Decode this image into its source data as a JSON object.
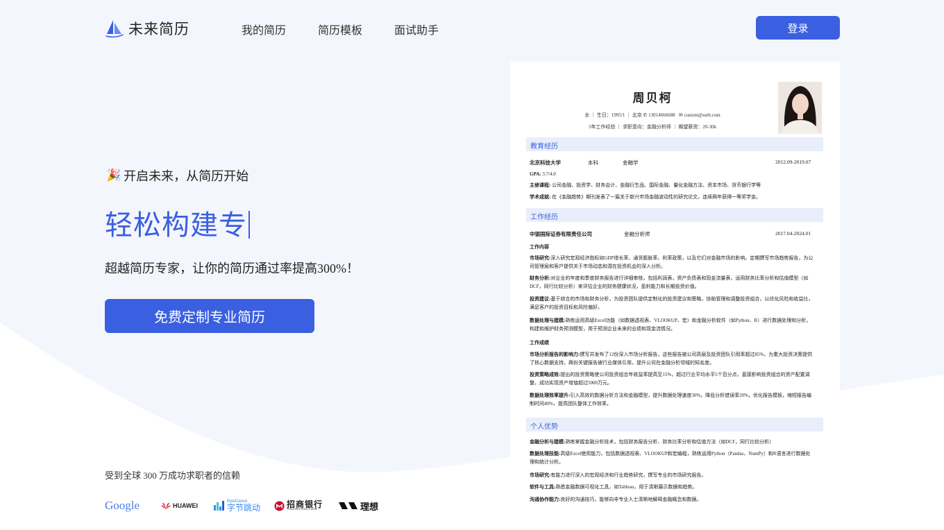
{
  "nav": {
    "logo_text": "未来简历",
    "links": [
      "我的简历",
      "简历模板",
      "面试助手"
    ],
    "login": "登录"
  },
  "hero": {
    "tagline": "开启未来，从简历开始",
    "title": "轻松构建专",
    "subtitle": "超越简历专家，让你的简历通过率提高300%！",
    "cta": "免费定制专业简历"
  },
  "trust": {
    "text": "受到全球 300 万成功求职者的信赖",
    "brands": [
      "Google",
      "HUAWEI",
      "ByteDance",
      "字节跳动",
      "招商银行",
      "CHINA MERCHANTS BANK",
      "理想"
    ]
  },
  "colors": {
    "accent": "#3a5fe0",
    "background": "#f4f6fd"
  },
  "resume": {
    "name": "周贝柯",
    "info1": {
      "gender": "女",
      "birth": "生日：1995/1",
      "city": "北京",
      "phone": "13014666688",
      "email": "custom@ustb.com"
    },
    "info2": {
      "experience": "5年工作经验",
      "intent": "求职意向：金融分析师",
      "salary": "期望薪资：20-30k"
    },
    "education": {
      "heading": "教育经历",
      "school": "北京科技大学",
      "degree": "本科",
      "major": "金融学",
      "period": "2012.09-2019.07",
      "gpa_label": "GPA:",
      "gpa": "3.7/4.0",
      "courses_label": "主修课程:",
      "courses": "公司金融、投资学、财务会计、金融衍生品、国际金融、量化金融方法、资本市场、货币银行学等",
      "achv_label": "学术成就:",
      "achv": "在《金融趋势》期刊发表了一篇关于新兴市场金融波动性的研究论文，连续两年获得一等奖学金。"
    },
    "work": {
      "heading": "工作经历",
      "company": "中银国际证券有限责任公司",
      "role": "金融分析师",
      "period": "2017.04-2024.01",
      "content_label": "工作内容",
      "items": [
        {
          "label": "市场研究:",
          "text": "深入研究宏观经济指标如GDP增长率、通货膨胀率、利率政策，以及它们对金融市场的影响。定期撰写市场趋势报告，为公司管理层和客户提供关于市场动态和潜在投资机会的深入分析。"
        },
        {
          "label": "财务分析:",
          "text": "对企业的年度和季度财务报告进行详细审核，包括利润表，资产负债表和现金流量表，运用财务比率分析和估值模型（如DCF，同行比较分析）来评估企业的财务健康状况，盈利能力和长期投资价值。"
        },
        {
          "label": "投资建议:",
          "text": "基于综合的市场和财务分析，为投资团队提供定制化的投资建议和策略，协助管理和调整投资组合，以优化风险和收益比，满足客户的投资目标和风险偏好。"
        },
        {
          "label": "数据处理与建模:",
          "text": "熟练运用高级Excel功能（如数据透视表、VLOOKUP、宏）和金融分析软件（如Python、R）进行数据处理和分析，构建和维护财务预测模型，用于预测企业未来的业绩和现金流情况。"
        }
      ],
      "results_label": "工作成绩",
      "results": [
        {
          "label": "市场分析报告的影响力:",
          "text": "撰写并发布了12份深入市场分析报告，这些报告被公司高层及投资团队引用率超过85%，为重大投资决策提供了核心数据支持，两份关键报告被行业媒体引用，提升公司在金融分析领域的知名度。"
        },
        {
          "label": "投资策略成效:",
          "text": "提出的投资策略使公司投资组合年收益率提高至15%，超过行业平均水平5个百分点，直接影响投资组合的资产配置调整，成功实现资产增值超过5000万元。"
        },
        {
          "label": "数据处理效率提升:",
          "text": "引入高效的数据分析方法和金融模型，提升数据处理速度30%，降低分析错误率20%，优化报告模板，缩短报告编制时间40%，提高团队整体工作效率。"
        }
      ]
    },
    "strengths": {
      "heading": "个人优势",
      "items": [
        {
          "label": "金融分析与建模:",
          "text": "熟练掌握金融分析技术，包括财务报告分析、财务比率分析和估值方法（如DCF，同行比较分析）"
        },
        {
          "label": "数据处理技能:",
          "text": "高级Excel使用能力，包括数据透视表、VLOOKUP和宏编程，熟练运用Python（Pandas、NumPy）和R语言进行数据处理和统计分析。"
        },
        {
          "label": "市场研究:",
          "text": "有能力进行深入的宏观经济和行业趋势研究，撰写专业的市场研究报告。"
        },
        {
          "label": "软件与工具:",
          "text": "熟悉金融数据可视化工具，如Tableau，用于清晰展示数据和趋势。"
        },
        {
          "label": "沟通协作能力:",
          "text": "良好的沟通技巧，能够向非专业人士清晰地解释金融概念和数据。"
        }
      ]
    }
  }
}
